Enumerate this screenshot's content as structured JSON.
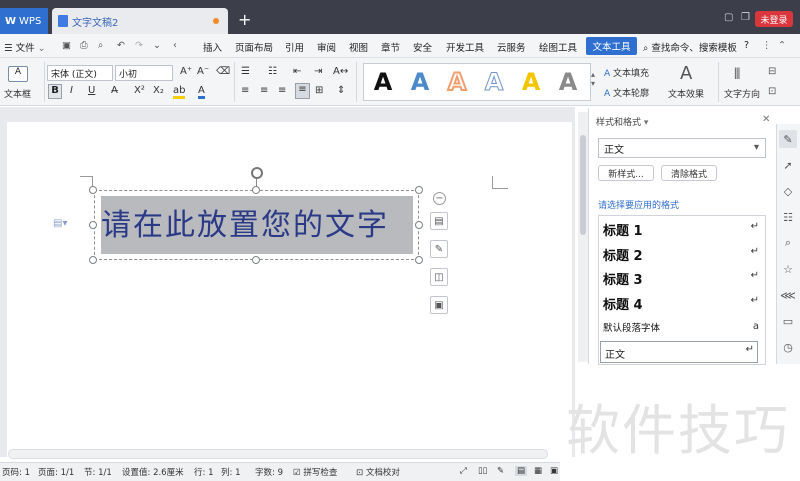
{
  "titlebar": {
    "app_label": "WPS",
    "doc_tab": "文字文稿2",
    "new_tab": "+",
    "login": "未登录"
  },
  "menubar": {
    "file": "文件",
    "items": [
      "插入",
      "页面布局",
      "引用",
      "审阅",
      "视图",
      "章节",
      "安全",
      "开发工具",
      "云服务",
      "绘图工具"
    ],
    "active": "文本工具",
    "search": "查找命令、搜索模板",
    "help": "?"
  },
  "ribbon": {
    "textbox_label": "文本框",
    "font_name": "宋体 (正文)",
    "font_size": "小初",
    "bold": "B",
    "italic": "I",
    "underline": "U",
    "art_letter": "A",
    "fill_label": "文本填充",
    "outline_label": "文本轮廓",
    "effect_label": "文本效果",
    "direction_label": "文字方向"
  },
  "art_colors": [
    "#111111",
    "#4c8ac9",
    "#f0a070",
    "#ffffff",
    "#f2c500",
    "#8a8a8a"
  ],
  "document": {
    "textbox_text": "请在此放置您的文字"
  },
  "panel": {
    "title": "样式和格式",
    "current_style": "正文",
    "new_style": "新样式...",
    "clear_format": "清除格式",
    "apply_label": "请选择要应用的格式",
    "styles": [
      "标题 1",
      "标题 2",
      "标题 3",
      "标题 4"
    ],
    "default_font": "默认段落字体",
    "normal": "正文"
  },
  "statusbar": {
    "page_code": "页码: 1",
    "page": "页面: 1/1",
    "section": "节: 1/1",
    "setting": "设置值: 2.6厘米",
    "row": "行: 1",
    "col": "列: 1",
    "words": "字数: 9",
    "spell": "拼写检查",
    "proof": "文档校对"
  },
  "watermark": "软件技巧"
}
